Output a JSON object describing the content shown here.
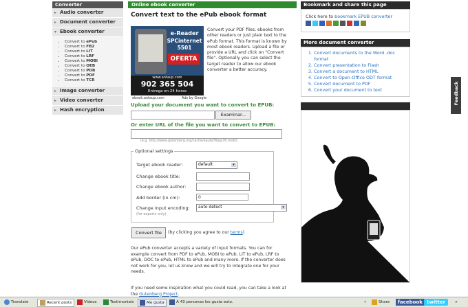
{
  "left": {
    "header": "Converter",
    "items": [
      {
        "label": "Audio converter"
      },
      {
        "label": "Document converter"
      },
      {
        "label": "Ebook converter"
      }
    ],
    "sub_items": [
      {
        "pre": "Convert to ",
        "fmt": "ePub"
      },
      {
        "pre": "Convert to ",
        "fmt": "FB2"
      },
      {
        "pre": "Convert to ",
        "fmt": "LIT"
      },
      {
        "pre": "Convert to ",
        "fmt": "LRF"
      },
      {
        "pre": "Convert to ",
        "fmt": "MOBI"
      },
      {
        "pre": "Convert to ",
        "fmt": "OEB"
      },
      {
        "pre": "Convert to ",
        "fmt": "PDB"
      },
      {
        "pre": "Convert to ",
        "fmt": "PDF"
      },
      {
        "pre": "Convert to ",
        "fmt": "TCR"
      }
    ],
    "items_after": [
      {
        "label": "Image converter"
      },
      {
        "label": "Video converter"
      },
      {
        "label": "Hash encryption"
      }
    ]
  },
  "center": {
    "header": "Online ebook converter",
    "title": "Convert text to the ePub ebook format",
    "description": "Convert your PDF files, ebooks from other readers or just plain text to the ePub format. This format is known by most ebook readers. Upload a file or provide a URL and click on \"Convert file\". Optionally you can select the target reader to allow our ebook converter a better accuracy.",
    "ad": {
      "line1": "e-Reader",
      "line2": "SPCinternet",
      "line3": "5501",
      "badge": "OFERTA",
      "site": "www.antaup.com",
      "phone": "902 365 504",
      "delivery": "Entrega en 24 horas",
      "caption_left": "ebook.antaup.com",
      "caption_right": "Ads by Google"
    },
    "upload_label": "Upload your document you want to convert to EPUB:",
    "browse_button": "Examinar...",
    "url_label": "Or enter URL of the file you want to convert to EPUB:",
    "url_hint": "(e.g. http://www.gutenberg.org/cache/epub/76/pg76.mobi)",
    "options": {
      "legend": "Optional settings",
      "target_label": "Target ebook reader:",
      "target_value": "default",
      "title_label": "Change ebook title:",
      "author_label": "Change ebook author:",
      "border_label": "Add border (in cm):",
      "border_value": "0",
      "encoding_label": "Change input encoding:",
      "encoding_value": "auto detect",
      "experts_note": "(for experts only)"
    },
    "convert_button": "Convert file",
    "agree_pre": "(by clicking you agree to our ",
    "agree_link": "terms",
    "agree_post": ")",
    "para1": "Our ePub converter accepts a variety of input formats. You can for example convert from PDF to ePub, MOBI to ePub, LIT to ePub, LRF to ePub, DOC to ePub, HTML to ePub and many more. If the converter does not work for you, let us know and we will try to integrate one for your needs.",
    "para2_pre": "If you need some inspiration what you could read, you can take a look at the ",
    "para2_link": "Gutenberg Project",
    "para2_post": "."
  },
  "right": {
    "bookmark_header": "Bookmark and share this page",
    "bookmark_pre": "Click here to ",
    "bookmark_link": "bookmark EPUB converter",
    "more_header": "More document converter",
    "links": [
      "Convert documents to the Word .doc format",
      "Convert presentation to Flash",
      "Convert a document to HTML",
      "Convert to Open-Office ODT format",
      "Convert document to PDF",
      "Convert your document to text"
    ]
  },
  "feedback_tab": "Feedback",
  "bottom_bar": {
    "translate": "Translate",
    "recent_posts": "Recent posts",
    "videos": "Videos",
    "testimonials": "Testimonials",
    "like": "Me gusta",
    "like_count": "A 43 personas les gusta esto.",
    "share": "Share",
    "facebook": "facebook",
    "twitter": "twitter"
  },
  "colors": {
    "accent_green": "#2e8b2e",
    "link_blue": "#2a6ebb",
    "dark_header": "#2b2b2b"
  }
}
